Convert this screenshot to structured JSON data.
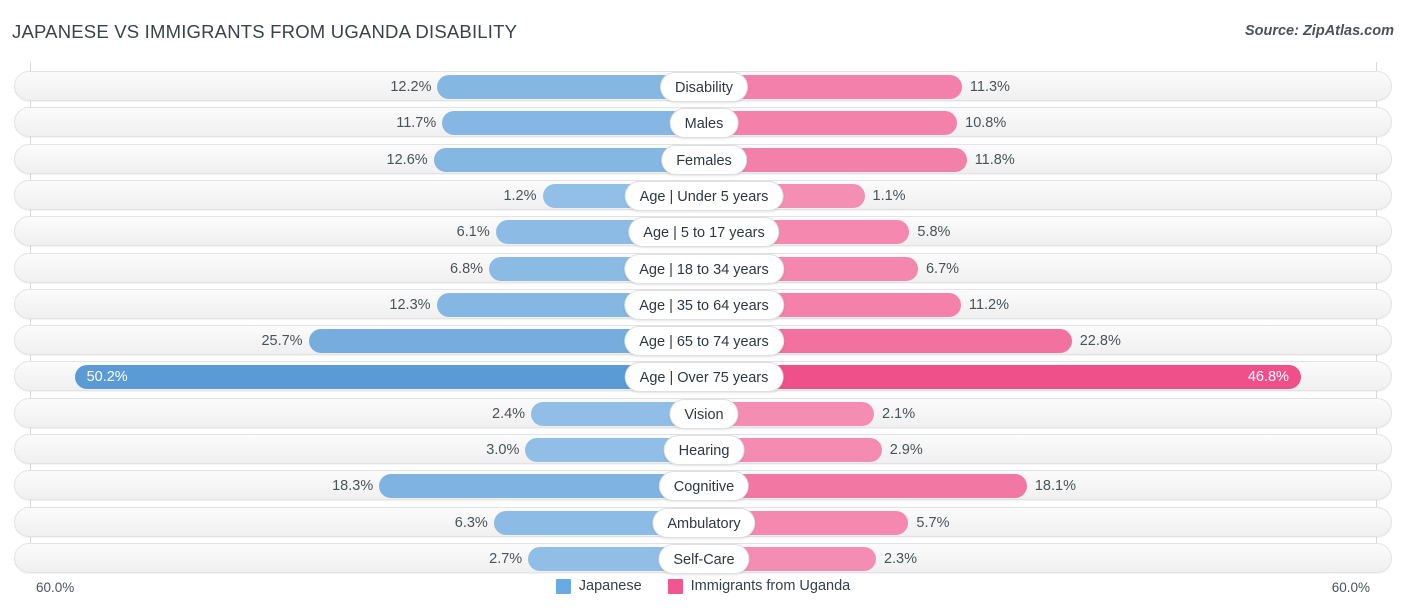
{
  "header": {
    "title": "JAPANESE VS IMMIGRANTS FROM UGANDA DISABILITY",
    "source": "Source: ZipAtlas.com"
  },
  "axis": {
    "left_label": "60.0%",
    "right_label": "60.0%",
    "max": 60.0
  },
  "legend": {
    "items": [
      {
        "label": "Japanese",
        "color": "#6aaae4"
      },
      {
        "label": "Immigrants from Uganda",
        "color": "#f2568f"
      }
    ]
  },
  "colors": {
    "left_base": "#93c0e8",
    "left_strong": "#5b9bd5",
    "right_base": "#f490b4",
    "right_strong": "#f04b86",
    "track": "#f5f5f5",
    "gridline": "#d9d9d9",
    "text": "#4a5358"
  },
  "chart_data": {
    "type": "bar",
    "subtype": "diverging-bidirectional",
    "title": "JAPANESE VS IMMIGRANTS FROM UGANDA DISABILITY",
    "xlabel": "",
    "ylabel": "",
    "xlim": [
      60.0,
      60.0
    ],
    "grid": true,
    "legend_position": "bottom-center",
    "categories": [
      "Disability",
      "Males",
      "Females",
      "Age | Under 5 years",
      "Age | 5 to 17 years",
      "Age | 18 to 34 years",
      "Age | 35 to 64 years",
      "Age | 65 to 74 years",
      "Age | Over 75 years",
      "Vision",
      "Hearing",
      "Cognitive",
      "Ambulatory",
      "Self-Care"
    ],
    "series": [
      {
        "name": "Japanese",
        "side": "left",
        "values": [
          12.2,
          11.7,
          12.6,
          1.2,
          6.1,
          6.8,
          12.3,
          25.7,
          50.2,
          2.4,
          3.0,
          18.3,
          6.3,
          2.7
        ],
        "labels": [
          "12.2%",
          "11.7%",
          "12.6%",
          "1.2%",
          "6.1%",
          "6.8%",
          "12.3%",
          "25.7%",
          "50.2%",
          "2.4%",
          "3.0%",
          "18.3%",
          "6.3%",
          "2.7%"
        ]
      },
      {
        "name": "Immigrants from Uganda",
        "side": "right",
        "values": [
          11.3,
          10.8,
          11.8,
          1.1,
          5.8,
          6.7,
          11.2,
          22.8,
          46.8,
          2.1,
          2.9,
          18.1,
          5.7,
          2.3
        ],
        "labels": [
          "11.3%",
          "10.8%",
          "11.8%",
          "1.1%",
          "5.8%",
          "6.7%",
          "11.2%",
          "22.8%",
          "46.8%",
          "2.1%",
          "2.9%",
          "18.1%",
          "5.7%",
          "2.3%"
        ]
      }
    ]
  },
  "rows": [
    {
      "label": "Disability",
      "left_value": 12.2,
      "left_label": "12.2%",
      "right_value": 11.3,
      "right_label": "11.3%"
    },
    {
      "label": "Males",
      "left_value": 11.7,
      "left_label": "11.7%",
      "right_value": 10.8,
      "right_label": "10.8%"
    },
    {
      "label": "Females",
      "left_value": 12.6,
      "left_label": "12.6%",
      "right_value": 11.8,
      "right_label": "11.8%"
    },
    {
      "label": "Age | Under 5 years",
      "left_value": 1.2,
      "left_label": "1.2%",
      "right_value": 1.1,
      "right_label": "1.1%"
    },
    {
      "label": "Age | 5 to 17 years",
      "left_value": 6.1,
      "left_label": "6.1%",
      "right_value": 5.8,
      "right_label": "5.8%"
    },
    {
      "label": "Age | 18 to 34 years",
      "left_value": 6.8,
      "left_label": "6.8%",
      "right_value": 6.7,
      "right_label": "6.7%"
    },
    {
      "label": "Age | 35 to 64 years",
      "left_value": 12.3,
      "left_label": "12.3%",
      "right_value": 11.2,
      "right_label": "11.2%"
    },
    {
      "label": "Age | 65 to 74 years",
      "left_value": 25.7,
      "left_label": "25.7%",
      "right_value": 22.8,
      "right_label": "22.8%"
    },
    {
      "label": "Age | Over 75 years",
      "left_value": 50.2,
      "left_label": "50.2%",
      "right_value": 46.8,
      "right_label": "46.8%"
    },
    {
      "label": "Vision",
      "left_value": 2.4,
      "left_label": "2.4%",
      "right_value": 2.1,
      "right_label": "2.1%"
    },
    {
      "label": "Hearing",
      "left_value": 3.0,
      "left_label": "3.0%",
      "right_value": 2.9,
      "right_label": "2.9%"
    },
    {
      "label": "Cognitive",
      "left_value": 18.3,
      "left_label": "18.3%",
      "right_value": 18.1,
      "right_label": "18.1%"
    },
    {
      "label": "Ambulatory",
      "left_value": 6.3,
      "left_label": "6.3%",
      "right_value": 5.7,
      "right_label": "5.7%"
    },
    {
      "label": "Self-Care",
      "left_value": 2.7,
      "left_label": "2.7%",
      "right_value": 2.3,
      "right_label": "2.3%"
    }
  ]
}
